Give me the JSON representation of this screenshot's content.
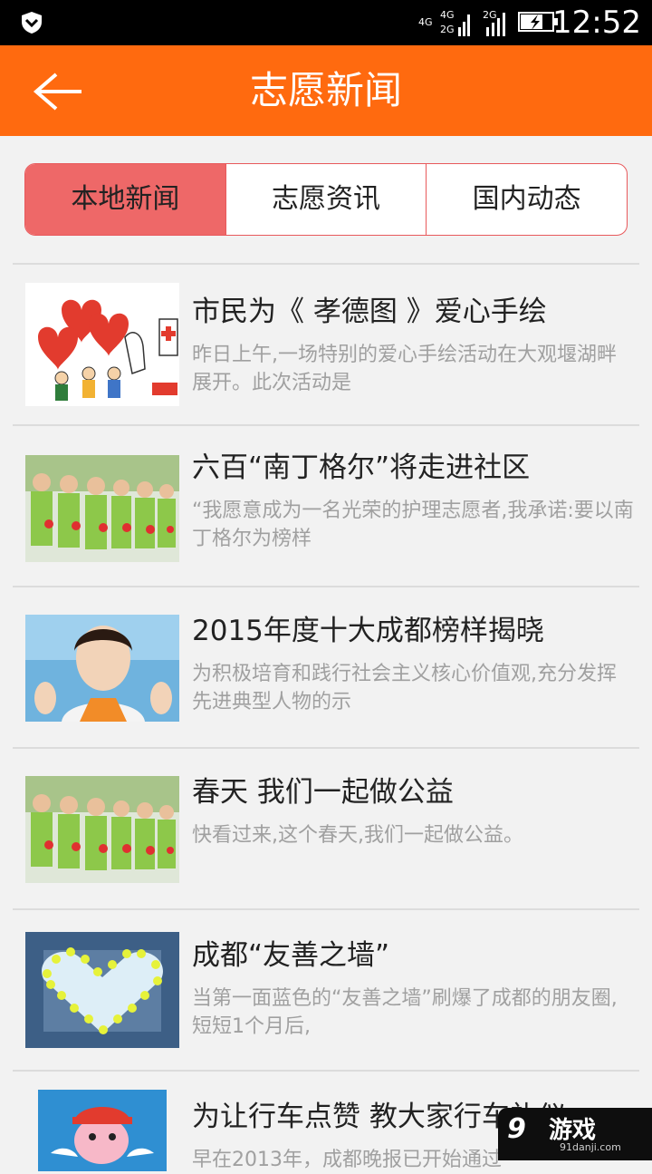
{
  "status_bar": {
    "network_1": "4G",
    "network_2": "4G",
    "network_3": "2G",
    "network_4": "2G",
    "time": "12:52"
  },
  "header": {
    "title": "志愿新闻"
  },
  "tabs": [
    {
      "label": "本地新闻",
      "active": true
    },
    {
      "label": "志愿资讯",
      "active": false
    },
    {
      "label": "国内动态",
      "active": false
    }
  ],
  "news": [
    {
      "title": "市民为《 孝德图 》爱心手绘",
      "desc": "昨日上午,一场特别的爱心手绘活动在大观堰湖畔展开。此次活动是",
      "image": "heart-volunteers-drawing"
    },
    {
      "title": "六百“南丁格尔”将走进社区",
      "desc": "“我愿意成为一名光荣的护理志愿者,我承诺:要以南丁格尔为榜样",
      "image": "nurses-row-photo"
    },
    {
      "title": "2015年度十大成都榜样揭晓",
      "desc": "为积极培育和践行社会主义核心价值观,充分发挥先进典型人物的示",
      "image": "smiling-woman-photo"
    },
    {
      "title": "春天 我们一起做公益",
      "desc": "快看过来,这个春天,我们一起做公益。",
      "image": "nurses-row-photo"
    },
    {
      "title": "成都“友善之墙”",
      "desc": "当第一面蓝色的“友善之墙”刷爆了成都的朋友圈,短短1个月后,",
      "image": "volunteers-heart-formation"
    },
    {
      "title": "为让行车点赞 教大家行车礼仪",
      "desc": "早在2013年，成都晚报已开始通过",
      "image": "mascot-cartoon"
    }
  ],
  "watermark": {
    "logo": "9",
    "main": "游戏",
    "sub": "91danji.com"
  }
}
